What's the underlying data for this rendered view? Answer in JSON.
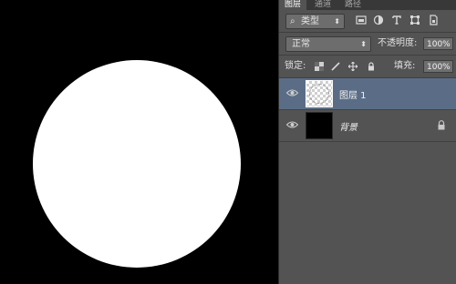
{
  "panel": {
    "tabs": [
      {
        "label": "图层",
        "active": true
      },
      {
        "label": "通道",
        "active": false
      },
      {
        "label": "路径",
        "active": false
      }
    ],
    "filter": {
      "glyph": "⌕",
      "value": "类型"
    },
    "filter_icons": [
      "image-icon",
      "adjustment-icon",
      "text-icon",
      "shape-icon",
      "smart-object-icon"
    ],
    "blend_mode": "正常",
    "opacity_label": "不透明度:",
    "opacity_value": "100%",
    "lock_label": "锁定:",
    "lock_icons": [
      "lock-transparent-icon",
      "lock-pixels-icon",
      "lock-position-icon",
      "lock-all-icon"
    ],
    "fill_label": "填充:",
    "fill_value": "100%",
    "layers": [
      {
        "name": "图层 1",
        "selected": true,
        "visible": true,
        "thumbnail": "transparent-with-circle"
      },
      {
        "name": "背景",
        "selected": false,
        "visible": true,
        "thumbnail": "black",
        "locked": true
      }
    ]
  },
  "colors": {
    "canvas": "#000000",
    "shape": "#ffffff",
    "panel_bg": "#535353",
    "selected_layer": "#5b6d86"
  }
}
